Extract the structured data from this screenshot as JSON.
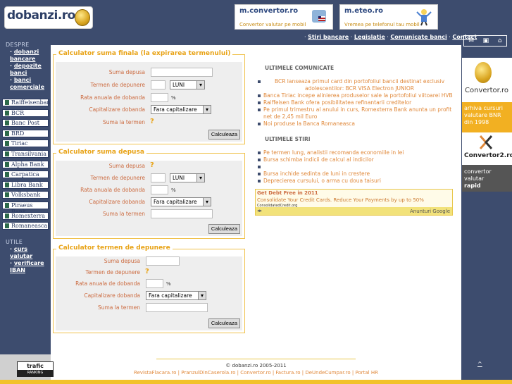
{
  "logo": {
    "text": "dobanzi.ro"
  },
  "banners": [
    {
      "title": "m.convertor.ro",
      "subtitle": "Convertor valutar pe mobil"
    },
    {
      "title": "m.eteo.ro",
      "subtitle": "Vremea pe telefonul tau mobil"
    }
  ],
  "topnav": [
    "Stiri bancare",
    "Legislatie",
    "Comunicate banci",
    "Contact"
  ],
  "sidebar": {
    "despre_head": "DESPRE",
    "despre_links": [
      "dobanzi bancare",
      "depozite banci",
      "banci comerciale"
    ],
    "banks": [
      "Raiffeisenbank",
      "BCR",
      "Banc Post",
      "BRD",
      "Tiriac",
      "Transilvania",
      "Alpha Bank",
      "Carpatica",
      "Libra Bank",
      "Volksbank",
      "Piraeus Bank",
      "Romexterra",
      "Romaneasca"
    ],
    "utile_head": "UTILE",
    "utile_links": [
      "curs valutar",
      "verificare IBAN"
    ]
  },
  "calc1": {
    "title": "Calculator suma finala (la expirarea termenului)",
    "labels": [
      "Suma depusa",
      "Termen de depunere",
      "Rata anuala de dobanda",
      "Capitalizare dobanda",
      "Suma la termen"
    ],
    "period": "LUNI",
    "capitalizare": "Fara capitalizare",
    "button": "Calculeaza"
  },
  "calc2": {
    "title": "Calculator suma depusa",
    "labels": [
      "Suma depusa",
      "Termen de depunere",
      "Rata anuala de dobanda",
      "Capitalizare dobanda",
      "Suma la termen"
    ],
    "period": "LUNI",
    "capitalizare": "Fara capitalizare",
    "button": "Calculeaza"
  },
  "calc3": {
    "title": "Calculator termen de depunere",
    "labels": [
      "Suma depusa",
      "Termen de depunere",
      "Rata anuala de dobanda",
      "Capitalizare dobanda",
      "Suma la termen"
    ],
    "capitalizare": "Fara capitalizare",
    "button": "Calculeaza"
  },
  "percent_sign": "%",
  "help": "?",
  "news": {
    "comunicate_head": "ULTIMELE COMUNICATE",
    "comunicate": [
      "BCR lanseaza primul card din portofoliul bancii destinat exclusiv adolescentilor: BCR VISA Electron JUNIOR",
      "Banca Tiriac incepe alinierea produselor sale la portofoliul viitoarei HVB",
      "Raiffeisen Bank ofera posibilitatea refinantarii creditelor",
      "Pe primul trimestru al anului in curs, Romexterra Bank anunta un profit net de 2,45 mil Euro",
      "Noi produse la Banca Romaneasca"
    ],
    "stiri_head": "ULTIMELE STIRI",
    "stiri": [
      "Pe termen lung, analistii recomanda economiile in lei",
      "Bursa schimba indicii de calcul al indicilor",
      "",
      "Bursa inchide sedinta de luni in crestere",
      "Deprecierea cursului, o arma cu doua taisuri"
    ]
  },
  "ad": {
    "headline": "Get Debt Free in 2011",
    "text": "Consolidate Your Credit Cards. Reduce Your Payments by up to 50%",
    "url": "ConsolidatedCredit.org",
    "badge": "Anunturi Google"
  },
  "right": {
    "conv1": "Convertor.ro",
    "arhiva": "arhiva cursuri valutare BNR din 1998",
    "conv2": "Convertor2.ro",
    "rapid1": "convertor valutar",
    "rapid2": "rapid"
  },
  "footer": {
    "copyright": "© dobanzi.ro 2005-2011",
    "links": "RevistaFlacara.ro | PranzulDinCaserola.ro | Convertor.ro | Factura.ro | DeUndeCumpar.ro | Portal HR"
  },
  "trafic": {
    "line1": "trafic",
    "line2": "RANKING"
  },
  "toplink": "^",
  "colors": {
    "bg": "#3d4c6e",
    "accent": "#e8a317",
    "link": "#e0883a"
  }
}
